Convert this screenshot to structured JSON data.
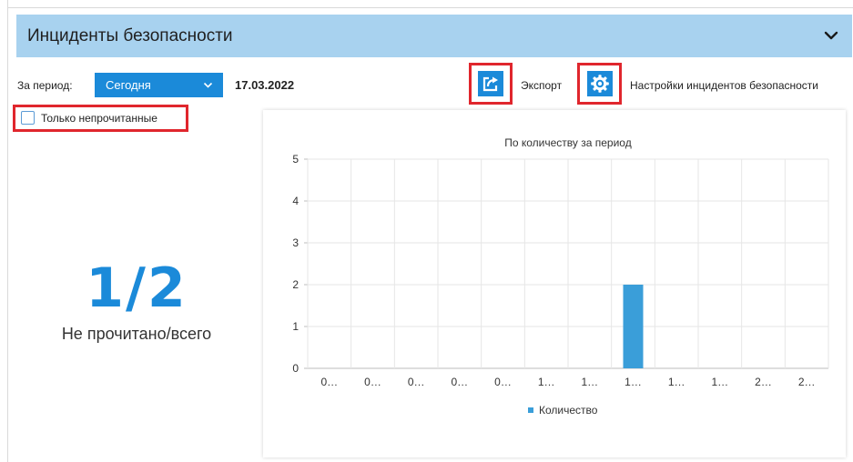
{
  "header": {
    "title": "Инциденты безопасности",
    "collapse_icon": "chevron-down-icon"
  },
  "toolbar": {
    "period_label": "За период:",
    "period_selected": "Сегодня",
    "date": "17.03.2022",
    "export_label": "Экспорт",
    "export_icon": "export-icon",
    "settings_label": "Настройки инцидентов безопасности",
    "settings_icon": "gear-icon"
  },
  "filter": {
    "unread_only_label": "Только непрочитанные",
    "unread_only_checked": false
  },
  "summary": {
    "value": "1/2",
    "caption": "Не прочитано/всего"
  },
  "colors": {
    "accent": "#1b8ad9",
    "header_bg": "#a8d2ef",
    "highlight": "#e0262d",
    "bar": "#3a9ed9"
  },
  "chart_data": {
    "type": "bar",
    "title": "По количеству за период",
    "categories": [
      "0…",
      "0…",
      "0…",
      "0…",
      "0…",
      "1…",
      "1…",
      "1…",
      "1…",
      "1…",
      "2…",
      "2…"
    ],
    "series": [
      {
        "name": "Количество",
        "values": [
          0,
          0,
          0,
          0,
          0,
          0,
          0,
          2,
          0,
          0,
          0,
          0
        ]
      }
    ],
    "ylim": [
      0,
      5
    ],
    "yticks": [
      0,
      1,
      2,
      3,
      4,
      5
    ],
    "grid": true,
    "legend": "bottom"
  }
}
